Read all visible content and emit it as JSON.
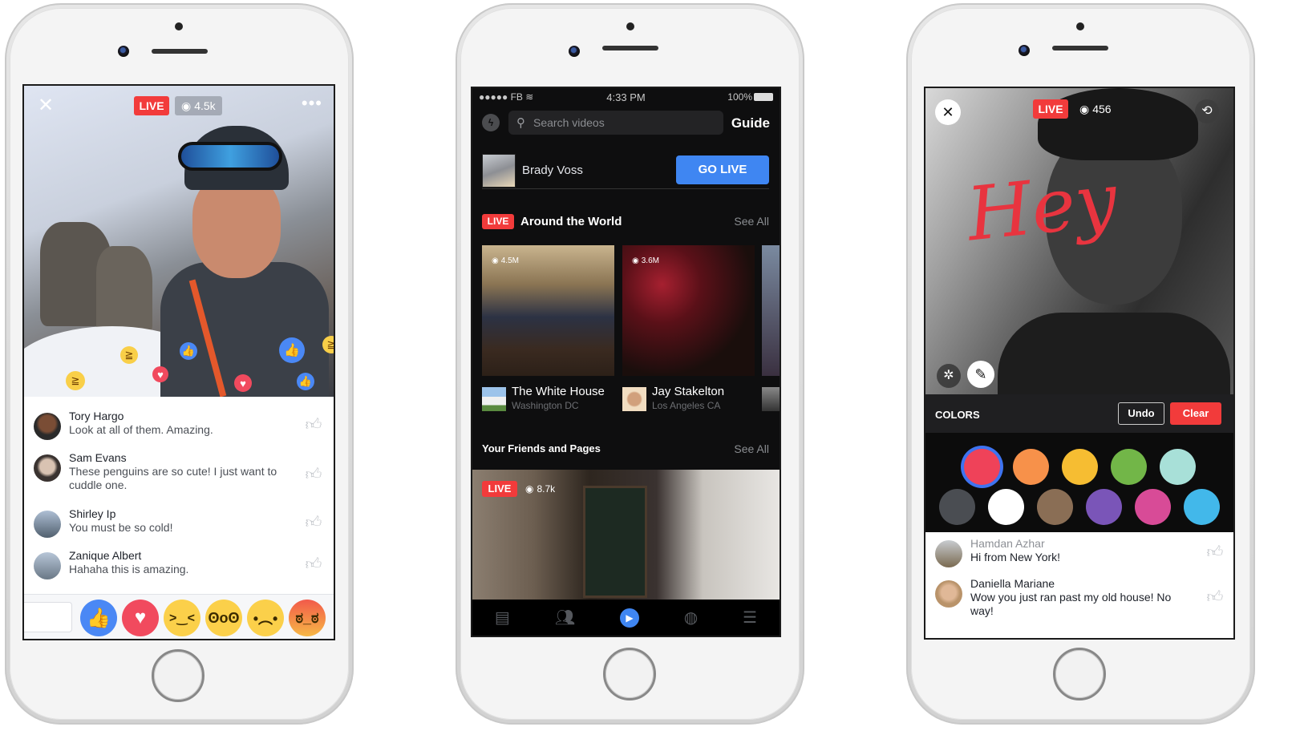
{
  "phone_left": {
    "overlay": {
      "live_label": "LIVE",
      "view_count": "4.5k"
    },
    "comments": [
      {
        "name": "Tory Hargo",
        "text": "Look at all of them. Amazing."
      },
      {
        "name": "Sam Evans",
        "text": "These penguins are so cute! I just want to cuddle one."
      },
      {
        "name": "Shirley Ip",
        "text": "You must be so cold!"
      },
      {
        "name": "Zanique Albert",
        "text": "Hahaha this is amazing."
      }
    ],
    "reactions": [
      "like",
      "love",
      "haha",
      "wow",
      "sad",
      "angry"
    ]
  },
  "phone_middle": {
    "status_bar": {
      "carrier": "●●●●● FB",
      "time": "4:33 PM",
      "battery": "100%"
    },
    "search": {
      "placeholder": "Search videos"
    },
    "guide_label": "Guide",
    "go_live": {
      "user_name": "Brady Voss",
      "button_label": "GO LIVE"
    },
    "around_the_world": {
      "live_label": "LIVE",
      "title": "Around the World",
      "see_all": "See All",
      "videos": [
        {
          "views": "4.5M",
          "title": "The White House",
          "subtitle": "Washington DC"
        },
        {
          "views": "3.6M",
          "title": "Jay Stakelton",
          "subtitle": "Los Angeles CA"
        }
      ]
    },
    "friends_and_pages": {
      "title": "Your Friends and Pages",
      "see_all": "See All",
      "featured": {
        "live_label": "LIVE",
        "views": "8.7k"
      }
    },
    "tab_bar": [
      "news-feed",
      "friends",
      "video",
      "globe",
      "menu"
    ]
  },
  "phone_right": {
    "overlay": {
      "live_label": "LIVE",
      "view_count": "456",
      "drawn_text": "Hey"
    },
    "toolbar": {
      "colors_label": "COLORS",
      "undo_label": "Undo",
      "clear_label": "Clear"
    },
    "palette": {
      "selected": "#ef4259",
      "colors": [
        "#ef4259",
        "#f7914a",
        "#f6bd32",
        "#72b648",
        "#a8e0d8",
        "#4a4d52",
        "#ffffff",
        "#8a6e55",
        "#7a55b8",
        "#d84b97",
        "#42b8ea"
      ]
    },
    "comments": [
      {
        "name": "Hamdan Azhar",
        "text": "Hi from New York!"
      },
      {
        "name": "Daniella Mariane",
        "text": "Wow you just ran past my old house! No way!"
      }
    ]
  }
}
